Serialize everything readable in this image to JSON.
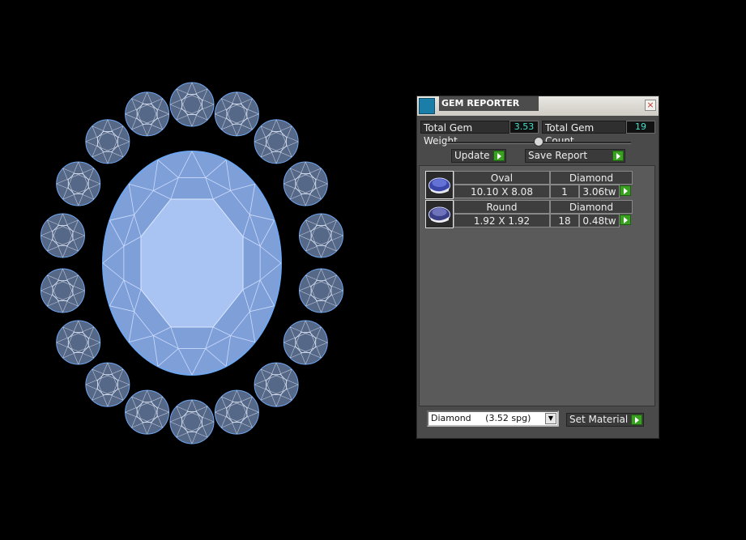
{
  "panel": {
    "title": "GEM REPORTER",
    "close_glyph": "×",
    "stats": {
      "weight_label": "Total Gem Weight",
      "weight_value": "3.53",
      "count_label": "Total Gem Count",
      "count_value": "19"
    },
    "buttons": {
      "update_label": "Update",
      "save_report_label": "Save Report",
      "set_material_label": "Set Material"
    },
    "gems": [
      {
        "shape": "Oval",
        "material": "Diamond",
        "size": "10.10 X 8.08",
        "count": "1",
        "weight": "3.06tw"
      },
      {
        "shape": "Round",
        "material": "Diamond",
        "size": "1.92 X 1.92",
        "count": "18",
        "weight": "0.48tw"
      }
    ],
    "material_select": {
      "value": "Diamond     (3.52 spg)",
      "arrow_glyph": "▼"
    }
  },
  "colors": {
    "background": "#000000",
    "panel_bg": "#4a4a4a",
    "value_text": "#45e0c8",
    "gem_stroke": "#6ea6f0",
    "gem_fill": "#9dbdf5",
    "play_green": "#3aa022"
  },
  "icons": [
    "app-icon",
    "close-icon",
    "play-icon",
    "dropdown-arrow-icon",
    "oval-gem-icon",
    "round-gem-icon"
  ]
}
